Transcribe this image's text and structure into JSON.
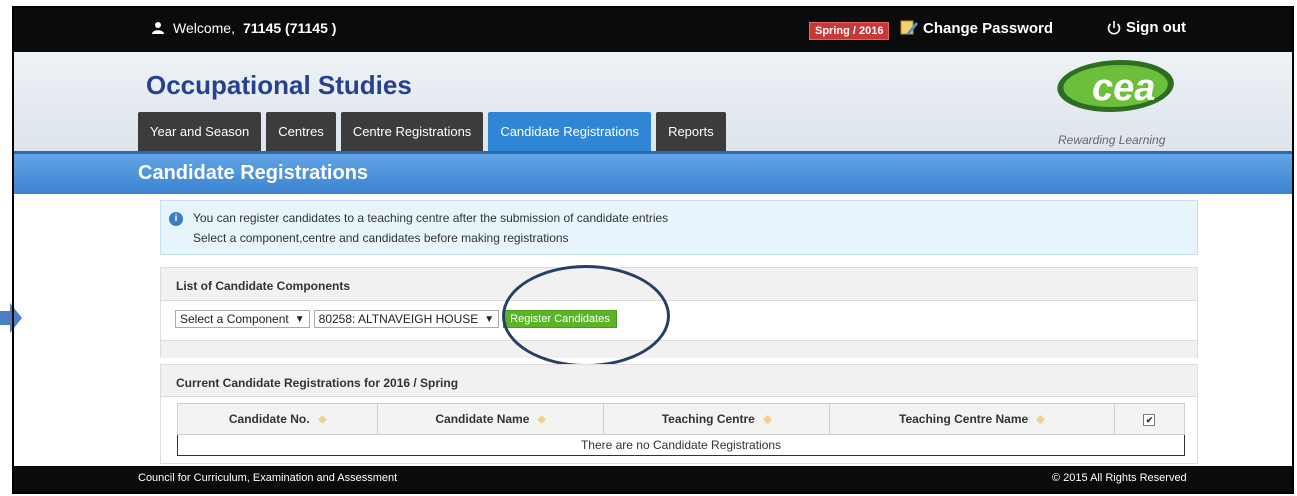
{
  "topbar": {
    "welcome_prefix": "Welcome,",
    "user_id": "71145 (71145 )",
    "season": "Spring / 2016",
    "change_password": "Change Password",
    "sign_out": "Sign out"
  },
  "header": {
    "app_title": "Occupational Studies",
    "logo_text": "cea",
    "logo_tagline": "Rewarding Learning"
  },
  "tabs": [
    {
      "label": "Year and Season"
    },
    {
      "label": "Centres"
    },
    {
      "label": "Centre Registrations"
    },
    {
      "label": "Candidate Registrations"
    },
    {
      "label": "Reports"
    }
  ],
  "page_title": "Candidate Registrations",
  "info": {
    "line1": "You can register candidates to a teaching centre after the submission of candidate entries",
    "line2": "Select a component,centre and candidates before making registrations"
  },
  "components_panel": {
    "title": "List of Candidate Components",
    "component_select": "Select a Component",
    "centre_select": "80258: ALTNAVEIGH HOUSE",
    "register_button": "Register Candidates"
  },
  "registrations_panel": {
    "title": "Current Candidate Registrations for 2016 / Spring",
    "columns": [
      "Candidate No.",
      "Candidate Name",
      "Teaching Centre",
      "Teaching Centre Name"
    ],
    "empty_message": "There are no Candidate Registrations"
  },
  "footer": {
    "left": "Council for Curriculum, Examination and Assessment",
    "right": "© 2015 All Rights Reserved"
  },
  "colors": {
    "accent": "#2e86d4",
    "title": "#25418f",
    "season_badge": "#c93838",
    "register_button": "#5ab426",
    "annotation": "#253f66"
  }
}
